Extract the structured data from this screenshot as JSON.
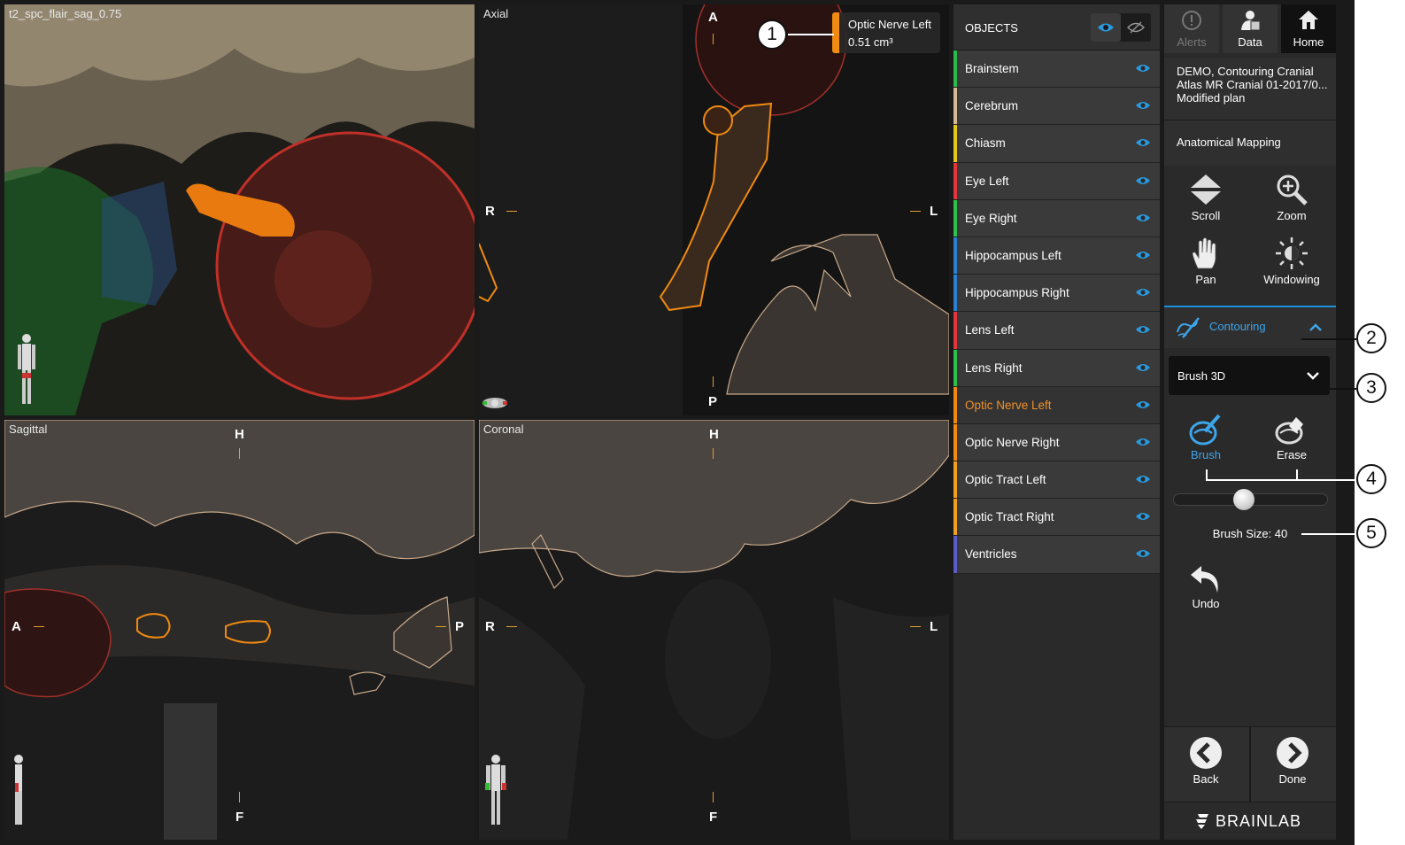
{
  "viewports": {
    "v3d": {
      "title": "t2_spc_flair_sag_0.75"
    },
    "axial": {
      "title": "Axial",
      "top": "A",
      "bottom": "P",
      "left": "R",
      "right": "L"
    },
    "sagittal": {
      "title": "Sagittal",
      "top": "H",
      "bottom": "F",
      "left": "A",
      "right": "P"
    },
    "coronal": {
      "title": "Coronal",
      "top": "H",
      "bottom": "F",
      "left": "R",
      "right": "L"
    }
  },
  "measurement": {
    "name": "Optic Nerve Left",
    "volume": "0.51 cm³",
    "color": "#f08a10"
  },
  "callouts": [
    "1",
    "2",
    "3",
    "4",
    "5"
  ],
  "objects": {
    "header": "OBJECTS",
    "items": [
      {
        "label": "Brainstem",
        "color": "#2db84a"
      },
      {
        "label": "Cerebrum",
        "color": "#d7b99a"
      },
      {
        "label": "Chiasm",
        "color": "#e8c619"
      },
      {
        "label": "Eye Left",
        "color": "#e0353a"
      },
      {
        "label": "Eye Right",
        "color": "#2ec04a"
      },
      {
        "label": "Hippocampus Left",
        "color": "#2c7fd1"
      },
      {
        "label": "Hippocampus Right",
        "color": "#2c7fd1"
      },
      {
        "label": "Lens Left",
        "color": "#e0353a"
      },
      {
        "label": "Lens Right",
        "color": "#2ec04a"
      },
      {
        "label": "Optic Nerve Left",
        "color": "#f08a10",
        "active": true
      },
      {
        "label": "Optic Nerve Right",
        "color": "#f08a10"
      },
      {
        "label": "Optic Tract Left",
        "color": "#f0a020"
      },
      {
        "label": "Optic Tract Right",
        "color": "#f0a020"
      },
      {
        "label": "Ventricles",
        "color": "#5c5cc8"
      }
    ]
  },
  "panel": {
    "tabs": {
      "alerts": "Alerts",
      "data": "Data",
      "home": "Home"
    },
    "plan": {
      "line1": "DEMO, Contouring Cranial",
      "line2": "Atlas MR Cranial 01-2017/0...",
      "line3": "Modified plan"
    },
    "mapping": "Anatomical Mapping",
    "tools": {
      "scroll": "Scroll",
      "zoom": "Zoom",
      "pan": "Pan",
      "windowing": "Windowing"
    },
    "contouring": "Contouring",
    "brush_mode": "Brush 3D",
    "brush": "Brush",
    "erase": "Erase",
    "brush_size_label": "Brush Size: 40",
    "brush_size": 40,
    "undo": "Undo",
    "back": "Back",
    "done": "Done",
    "brand": "BRAINLAB"
  }
}
